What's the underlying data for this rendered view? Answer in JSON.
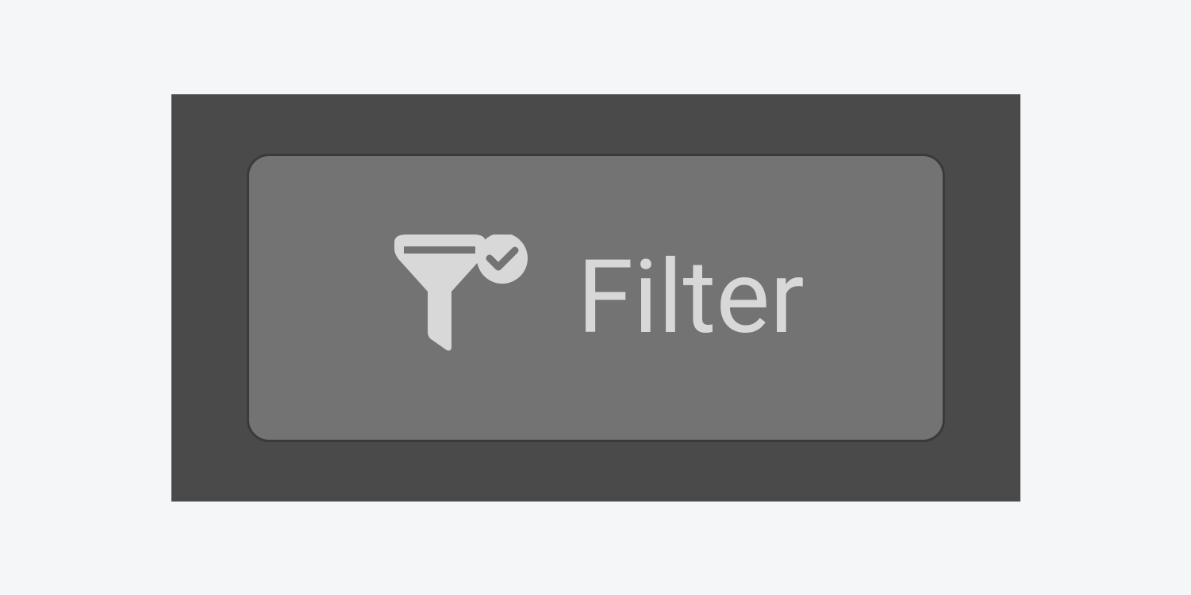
{
  "button": {
    "label": "Filter",
    "icon_name": "funnel-check-icon"
  },
  "colors": {
    "background": "#f5f6f7",
    "panel": "#4a4a4a",
    "button_bg": "#737373",
    "button_border": "#3a3a3a",
    "text": "#d8d8d8",
    "icon": "#d8d8d8"
  }
}
